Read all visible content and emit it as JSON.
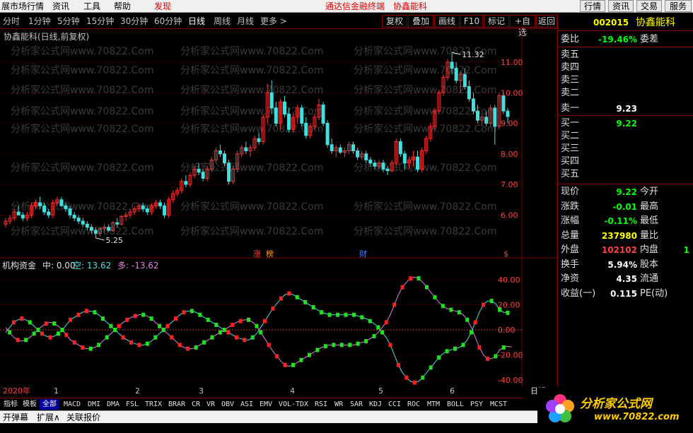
{
  "menubar": {
    "items": [
      "展市场行情",
      "资讯",
      "工具",
      "帮助",
      "发现"
    ],
    "center": [
      "通达信金融终端",
      "协鑫能科"
    ],
    "right_buttons": [
      "行情",
      "资讯",
      "交易",
      "服务"
    ]
  },
  "toolbar": {
    "periods": [
      "分时",
      "1分钟",
      "5分钟",
      "15分钟",
      "30分钟",
      "60分钟",
      "日线",
      "周线",
      "月线",
      "更多 >"
    ],
    "active_period": "日线",
    "buttons": [
      "复权",
      "叠加",
      "画线",
      "F10",
      "标记",
      "+自选",
      "返回"
    ]
  },
  "main_chart": {
    "title": "协鑫能科(日线,前复权)",
    "high_label": "11.32",
    "low_label": "5.25",
    "y_ticks": [
      "11.00",
      "10.00",
      "9.00",
      "8.00",
      "7.00",
      "6.00"
    ],
    "watermark": "分析家公式网www.70822.Com",
    "event_marks": [
      "涨",
      "榜",
      "财",
      "$"
    ]
  },
  "indicator": {
    "name": "机构资金",
    "mid_label": "中: 0.00",
    "kong_label": "空: 13.62",
    "duo_label": "多: -13.62",
    "y_ticks": [
      "40.00",
      "20.00",
      "0.00",
      "-20.00",
      "-40.00"
    ]
  },
  "datebar": {
    "year": "2020年",
    "months": [
      "1",
      "2",
      "3",
      "4",
      "5",
      "6"
    ],
    "right_label": "日线"
  },
  "quote": {
    "code": "002015",
    "name": "协鑫能科",
    "weibi_label": "委比",
    "weibi_value": "-19.46%",
    "weicha_label": "委差",
    "sell_labels": [
      "卖五",
      "卖四",
      "卖三",
      "卖二",
      "卖一"
    ],
    "sell1_price": "9.23",
    "buy_labels": [
      "买一",
      "买二",
      "买三",
      "买四",
      "买五"
    ],
    "buy1_price": "9.22",
    "rows": [
      {
        "l": "现价",
        "v": "9.22",
        "c": "#00ff00",
        "r": "今开"
      },
      {
        "l": "涨跌",
        "v": "-0.01",
        "c": "#00ff00",
        "r": "最高"
      },
      {
        "l": "涨幅",
        "v": "-0.11%",
        "c": "#00ff00",
        "r": "最低"
      },
      {
        "l": "总量",
        "v": "237980",
        "c": "#ffff00",
        "r": "量比"
      },
      {
        "l": "外盘",
        "v": "102102",
        "c": "#ff4040",
        "r": "内盘"
      },
      {
        "l": "换手",
        "v": "5.94%",
        "c": "#ffffff",
        "r": "股本"
      },
      {
        "l": "净资",
        "v": "4.35",
        "c": "#ffffff",
        "r": "流通"
      },
      {
        "l": "收益(一)",
        "v": "0.115",
        "c": "#ffffff",
        "r": "PE(动)"
      }
    ],
    "neipan_tail": "1"
  },
  "bottom_tabs": [
    "指标",
    "模板",
    "全部",
    "MACD",
    "DMI",
    "DMA",
    "FSL",
    "TRIX",
    "BRAR",
    "CR",
    "VR",
    "OBV",
    "ASI",
    "EMV",
    "VOL-TDX",
    "RSI",
    "WR",
    "SAR",
    "KDJ",
    "CCI",
    "ROC",
    "MTM",
    "BOLL",
    "PSY",
    "MCST"
  ],
  "selected_tab": "全部",
  "statusbar": [
    "开弹幕",
    "扩展∧",
    "关联报价"
  ],
  "logo": {
    "text": "分析家公式网",
    "url": "www.70822.com"
  },
  "chart_data": {
    "type": "candlestick",
    "title": "协鑫能科(日线,前复权)",
    "ylim": [
      4.9,
      11.6
    ],
    "candles": [
      [
        5.7,
        5.9,
        5.6,
        5.8
      ],
      [
        5.8,
        6.0,
        5.7,
        5.9
      ],
      [
        5.9,
        6.2,
        5.8,
        6.1
      ],
      [
        6.1,
        6.3,
        6.0,
        6.0
      ],
      [
        6.0,
        6.1,
        5.8,
        5.9
      ],
      [
        5.9,
        6.1,
        5.8,
        6.0
      ],
      [
        6.0,
        6.4,
        5.9,
        6.3
      ],
      [
        6.3,
        6.5,
        6.2,
        6.4
      ],
      [
        6.4,
        6.6,
        6.2,
        6.3
      ],
      [
        6.3,
        6.4,
        6.0,
        6.1
      ],
      [
        6.1,
        6.2,
        5.9,
        6.0
      ],
      [
        6.0,
        6.5,
        5.9,
        6.4
      ],
      [
        6.4,
        6.6,
        6.3,
        6.5
      ],
      [
        6.5,
        6.6,
        6.3,
        6.3
      ],
      [
        6.3,
        6.4,
        6.1,
        6.2
      ],
      [
        6.2,
        6.3,
        5.9,
        6.0
      ],
      [
        6.0,
        6.1,
        5.8,
        5.9
      ],
      [
        5.9,
        6.0,
        5.7,
        5.8
      ],
      [
        5.8,
        5.9,
        5.6,
        5.7
      ],
      [
        5.7,
        5.8,
        5.5,
        5.6
      ],
      [
        5.6,
        5.7,
        5.4,
        5.5
      ],
      [
        5.5,
        5.6,
        5.25,
        5.4
      ],
      [
        5.4,
        5.6,
        5.3,
        5.55
      ],
      [
        5.55,
        5.7,
        5.4,
        5.6
      ],
      [
        5.6,
        5.7,
        5.45,
        5.5
      ],
      [
        5.5,
        5.8,
        5.45,
        5.75
      ],
      [
        5.75,
        5.9,
        5.6,
        5.7
      ],
      [
        5.7,
        6.0,
        5.65,
        5.95
      ],
      [
        5.95,
        6.1,
        5.8,
        6.0
      ],
      [
        6.0,
        6.2,
        5.9,
        6.1
      ],
      [
        6.1,
        6.3,
        6.0,
        6.2
      ],
      [
        6.2,
        6.4,
        6.1,
        6.3
      ],
      [
        6.3,
        6.4,
        6.1,
        6.2
      ],
      [
        6.2,
        6.3,
        6.0,
        6.1
      ],
      [
        6.1,
        6.4,
        6.0,
        6.3
      ],
      [
        6.3,
        6.5,
        6.2,
        6.4
      ],
      [
        6.4,
        6.5,
        6.2,
        6.3
      ],
      [
        6.3,
        6.4,
        5.9,
        6.0
      ],
      [
        6.0,
        6.6,
        5.9,
        6.5
      ],
      [
        6.5,
        6.8,
        6.4,
        6.7
      ],
      [
        6.7,
        6.9,
        6.6,
        6.8
      ],
      [
        6.8,
        7.2,
        6.7,
        7.1
      ],
      [
        7.1,
        7.3,
        6.9,
        7.0
      ],
      [
        7.0,
        7.4,
        6.9,
        7.3
      ],
      [
        7.3,
        7.6,
        7.2,
        7.5
      ],
      [
        7.5,
        7.7,
        7.3,
        7.4
      ],
      [
        7.4,
        7.5,
        7.1,
        7.2
      ],
      [
        7.2,
        7.6,
        7.1,
        7.5
      ],
      [
        7.5,
        7.9,
        7.4,
        7.8
      ],
      [
        7.8,
        8.2,
        7.7,
        8.1
      ],
      [
        8.1,
        8.3,
        7.9,
        8.0
      ],
      [
        8.0,
        8.1,
        7.6,
        7.7
      ],
      [
        7.7,
        7.8,
        7.0,
        7.1
      ],
      [
        7.1,
        7.6,
        7.0,
        7.5
      ],
      [
        7.5,
        8.1,
        7.4,
        8.0
      ],
      [
        8.0,
        8.3,
        7.9,
        8.2
      ],
      [
        8.2,
        8.4,
        8.0,
        8.1
      ],
      [
        8.1,
        8.3,
        7.9,
        8.2
      ],
      [
        8.2,
        8.6,
        8.1,
        8.5
      ],
      [
        8.5,
        8.7,
        8.3,
        8.4
      ],
      [
        8.4,
        9.3,
        8.3,
        9.2
      ],
      [
        9.2,
        10.3,
        9.0,
        10.0
      ],
      [
        10.0,
        10.4,
        9.3,
        9.5
      ],
      [
        9.5,
        9.7,
        8.9,
        9.0
      ],
      [
        9.0,
        9.8,
        8.8,
        9.7
      ],
      [
        9.7,
        9.9,
        9.2,
        9.3
      ],
      [
        9.3,
        9.5,
        8.7,
        8.8
      ],
      [
        8.8,
        9.3,
        8.7,
        9.2
      ],
      [
        9.2,
        9.6,
        9.0,
        9.5
      ],
      [
        9.5,
        9.6,
        8.9,
        9.0
      ],
      [
        9.0,
        9.2,
        8.5,
        8.6
      ],
      [
        8.6,
        9.0,
        8.5,
        8.9
      ],
      [
        8.9,
        9.3,
        8.8,
        9.2
      ],
      [
        9.2,
        9.8,
        9.1,
        9.6
      ],
      [
        9.6,
        9.7,
        8.9,
        9.0
      ],
      [
        9.0,
        9.1,
        8.2,
        8.3
      ],
      [
        8.3,
        8.5,
        8.0,
        8.1
      ],
      [
        8.1,
        8.3,
        7.9,
        8.2
      ],
      [
        8.2,
        8.3,
        8.0,
        8.05
      ],
      [
        8.05,
        8.2,
        7.9,
        8.1
      ],
      [
        8.1,
        8.4,
        8.0,
        8.3
      ],
      [
        8.3,
        8.4,
        8.0,
        8.1
      ],
      [
        8.1,
        8.2,
        7.8,
        7.9
      ],
      [
        7.9,
        8.1,
        7.8,
        8.0
      ],
      [
        8.0,
        8.1,
        7.7,
        7.8
      ],
      [
        7.8,
        7.9,
        7.6,
        7.7
      ],
      [
        7.7,
        7.8,
        7.5,
        7.6
      ],
      [
        7.6,
        7.8,
        7.5,
        7.7
      ],
      [
        7.7,
        7.8,
        7.4,
        7.5
      ],
      [
        7.5,
        7.6,
        7.3,
        7.45
      ],
      [
        7.45,
        7.8,
        7.4,
        7.7
      ],
      [
        7.7,
        8.5,
        7.6,
        8.4
      ],
      [
        8.4,
        8.5,
        7.9,
        8.0
      ],
      [
        8.0,
        8.1,
        7.5,
        7.7
      ],
      [
        7.7,
        7.9,
        7.5,
        7.8
      ],
      [
        7.8,
        8.1,
        7.6,
        7.9
      ],
      [
        7.9,
        8.1,
        7.4,
        7.5
      ],
      [
        7.5,
        8.2,
        7.4,
        8.1
      ],
      [
        8.1,
        8.6,
        8.0,
        8.5
      ],
      [
        8.5,
        9.0,
        8.4,
        8.9
      ],
      [
        8.9,
        9.5,
        8.8,
        9.4
      ],
      [
        9.4,
        10.1,
        9.3,
        10.0
      ],
      [
        10.0,
        10.6,
        9.9,
        10.5
      ],
      [
        10.5,
        11.1,
        10.4,
        11.0
      ],
      [
        11.0,
        11.32,
        10.6,
        10.8
      ],
      [
        10.8,
        11.0,
        10.3,
        10.4
      ],
      [
        10.4,
        10.7,
        10.0,
        10.6
      ],
      [
        10.6,
        10.8,
        10.1,
        10.2
      ],
      [
        10.2,
        10.4,
        9.7,
        9.8
      ],
      [
        9.8,
        10.0,
        9.3,
        9.4
      ],
      [
        9.4,
        9.6,
        9.0,
        9.1
      ],
      [
        9.1,
        9.3,
        8.9,
        9.2
      ],
      [
        9.2,
        9.4,
        8.9,
        9.0
      ],
      [
        9.0,
        9.6,
        8.9,
        9.5
      ],
      [
        9.5,
        9.6,
        8.3,
        8.9
      ],
      [
        8.9,
        10.0,
        8.8,
        9.9
      ],
      [
        9.9,
        10.0,
        9.3,
        9.4
      ],
      [
        9.4,
        9.5,
        9.0,
        9.22
      ]
    ],
    "indicator": {
      "name": "机构资金",
      "ylim": [
        -45,
        45
      ],
      "kong": [
        -2,
        2,
        6,
        8,
        9,
        8,
        6,
        3,
        0,
        -3,
        -5,
        -6,
        -5,
        -3,
        0,
        4,
        8,
        10,
        12,
        14,
        15,
        15,
        14,
        12,
        9,
        6,
        3,
        0,
        -3,
        -6,
        -8,
        -10,
        -11,
        -12,
        -12,
        -11,
        -9,
        -6,
        -3,
        0,
        3,
        6,
        9,
        12,
        14,
        15,
        15,
        14,
        12,
        10,
        8,
        6,
        4,
        2,
        0,
        -2,
        -4,
        -6,
        -7,
        -8,
        -8,
        -6,
        -3,
        2,
        7,
        12,
        17,
        21,
        25,
        28,
        29,
        28,
        26,
        24,
        22,
        20,
        18,
        16,
        14,
        13,
        12,
        12,
        12,
        12,
        12,
        12,
        12,
        11,
        10,
        9,
        7,
        5,
        2,
        -2,
        -6,
        -12,
        -20,
        -28,
        -34,
        -38,
        -41,
        -42,
        -41,
        -38,
        -34,
        -30,
        -26,
        -22,
        -19,
        -17,
        -16,
        -15,
        -14,
        -12,
        -8,
        -2,
        6,
        14,
        20,
        23,
        23,
        21,
        16,
        14,
        13.62
      ],
      "duo": [
        2,
        -2,
        -6,
        -8,
        -9,
        -8,
        -6,
        -3,
        0,
        3,
        5,
        6,
        5,
        3,
        0,
        -4,
        -8,
        -10,
        -12,
        -14,
        -15,
        -15,
        -14,
        -12,
        -9,
        -6,
        -3,
        0,
        3,
        6,
        8,
        10,
        11,
        12,
        12,
        11,
        9,
        6,
        3,
        0,
        -3,
        -6,
        -9,
        -12,
        -14,
        -15,
        -15,
        -14,
        -12,
        -10,
        -8,
        -6,
        -4,
        -2,
        0,
        2,
        4,
        6,
        7,
        8,
        8,
        6,
        3,
        -2,
        -7,
        -12,
        -17,
        -21,
        -25,
        -28,
        -29,
        -28,
        -26,
        -24,
        -22,
        -20,
        -18,
        -16,
        -14,
        -13,
        -12,
        -12,
        -12,
        -12,
        -12,
        -12,
        -12,
        -11,
        -10,
        -9,
        -7,
        -5,
        -2,
        2,
        6,
        12,
        20,
        28,
        34,
        38,
        41,
        42,
        41,
        38,
        34,
        30,
        26,
        22,
        19,
        17,
        16,
        15,
        14,
        12,
        8,
        2,
        -6,
        -14,
        -20,
        -23,
        -23,
        -21,
        -16,
        -14,
        -13,
        -13.62
      ]
    }
  }
}
